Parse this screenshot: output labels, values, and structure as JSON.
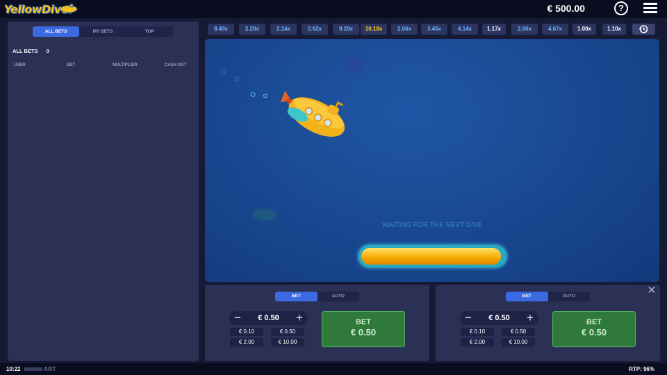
{
  "header": {
    "logo_text": "YellowDiver",
    "balance": "€ 500.00",
    "help_glyph": "?"
  },
  "left_panel": {
    "tabs": [
      {
        "label": "ALL BETS",
        "active": true
      },
      {
        "label": "MY BETS",
        "active": false
      },
      {
        "label": "TOP",
        "active": false
      }
    ],
    "all_bets_label": "ALL BETS",
    "all_bets_count": "0",
    "columns": [
      "USER",
      "BET",
      "MULTIPLIER",
      "CASH OUT"
    ]
  },
  "history": [
    {
      "value": "8.49x",
      "color": "#6fb7ff"
    },
    {
      "value": "2.20x",
      "color": "#6fb7ff"
    },
    {
      "value": "2.14x",
      "color": "#6fb7ff"
    },
    {
      "value": "2.62x",
      "color": "#6fb7ff"
    },
    {
      "value": "9.28x",
      "color": "#6fb7ff"
    },
    {
      "value": "10.18x",
      "color": "#ffd21a"
    },
    {
      "value": "2.06x",
      "color": "#6fb7ff"
    },
    {
      "value": "3.45x",
      "color": "#6fb7ff"
    },
    {
      "value": "4.14x",
      "color": "#6fb7ff"
    },
    {
      "value": "1.17x",
      "color": "#ffffff"
    },
    {
      "value": "2.66x",
      "color": "#6fb7ff"
    },
    {
      "value": "4.67x",
      "color": "#6fb7ff"
    },
    {
      "value": "1.00x",
      "color": "#ffffff"
    },
    {
      "value": "1.10x",
      "color": "#ffffff"
    }
  ],
  "stage": {
    "status_text": "WAITING FOR THE NEXT DIVE",
    "progress": 0.98
  },
  "bet_panels": [
    {
      "tabs": [
        {
          "label": "BET",
          "active": true
        },
        {
          "label": "AUTO",
          "active": false
        }
      ],
      "stake": "€ 0.50",
      "quick_bets": [
        "€ 0.10",
        "€ 0.50",
        "€ 2.00",
        "€ 10.00"
      ],
      "bet_button_line1": "BET",
      "bet_button_line2": "€ 0.50"
    },
    {
      "tabs": [
        {
          "label": "BET",
          "active": true
        },
        {
          "label": "AUTO",
          "active": false
        }
      ],
      "stake": "€ 0.50",
      "quick_bets": [
        "€ 0.10",
        "€ 0.50",
        "€ 2.00",
        "€ 10.00"
      ],
      "bet_button_line1": "BET",
      "bet_button_line2": "€ 0.50"
    }
  ],
  "footer": {
    "time": "10:22",
    "brand": "ART",
    "rtp": "RTP: 96%"
  },
  "icons": {
    "help": "help-icon",
    "menu": "menu-icon",
    "history": "history-icon",
    "close": "close-icon",
    "minus": "minus-icon",
    "plus": "plus-icon"
  },
  "colors": {
    "accent": "#3b6ae0",
    "bet_button": "#2f7a3a",
    "stage": "#1a4a93",
    "panel": "#2b3055"
  }
}
